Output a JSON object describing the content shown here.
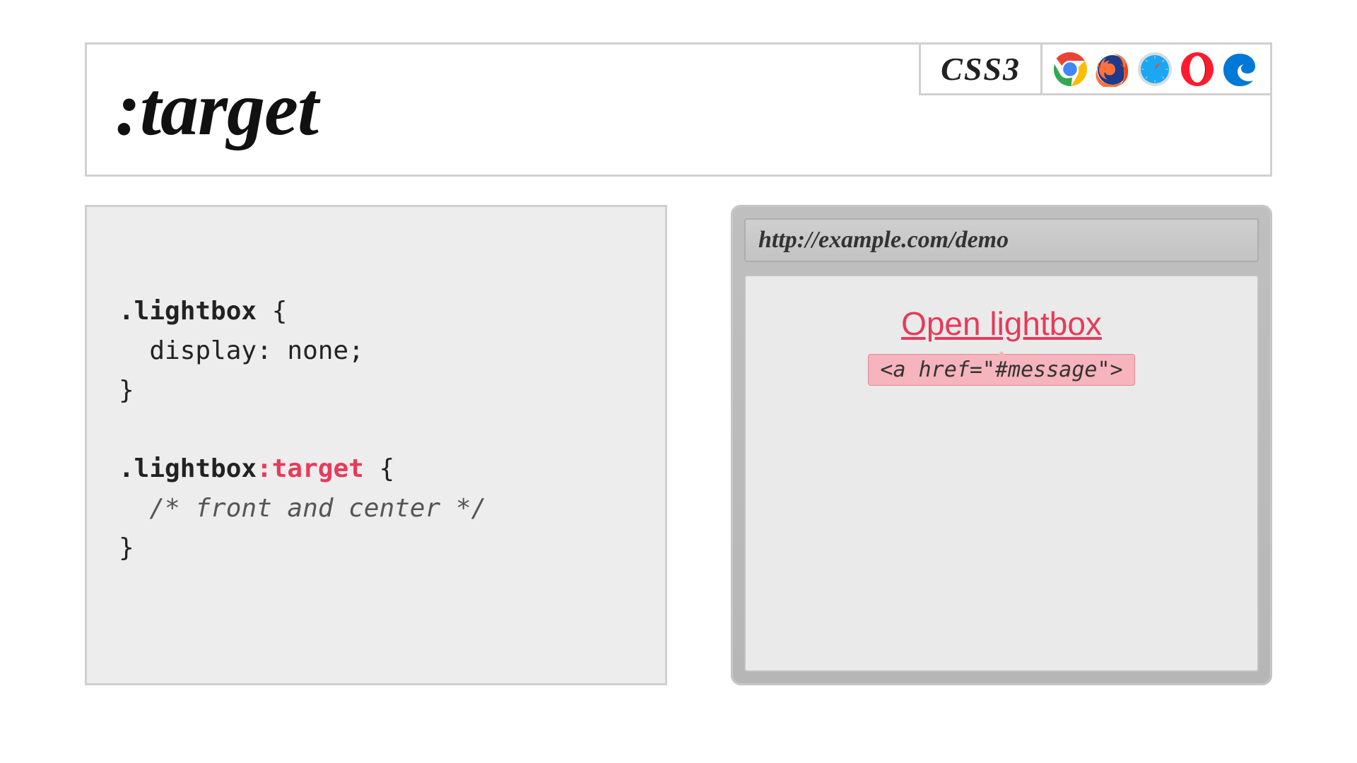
{
  "header": {
    "title": ":target",
    "spec": "CSS3",
    "browsers": [
      "chrome",
      "firefox",
      "safari",
      "opera",
      "edge"
    ]
  },
  "code": {
    "line1_sel": ".lightbox",
    "line1_brace": " {",
    "line2": "  display: none;",
    "line3": "}",
    "line5_sel": ".lightbox",
    "line5_hl": ":target",
    "line5_brace": " {",
    "line6_comment": "  /* front and center */",
    "line7": "}"
  },
  "demo": {
    "url": "http://example.com/demo",
    "link_text": "Open lightbox",
    "tooltip": "<a href=\"#message\">"
  }
}
